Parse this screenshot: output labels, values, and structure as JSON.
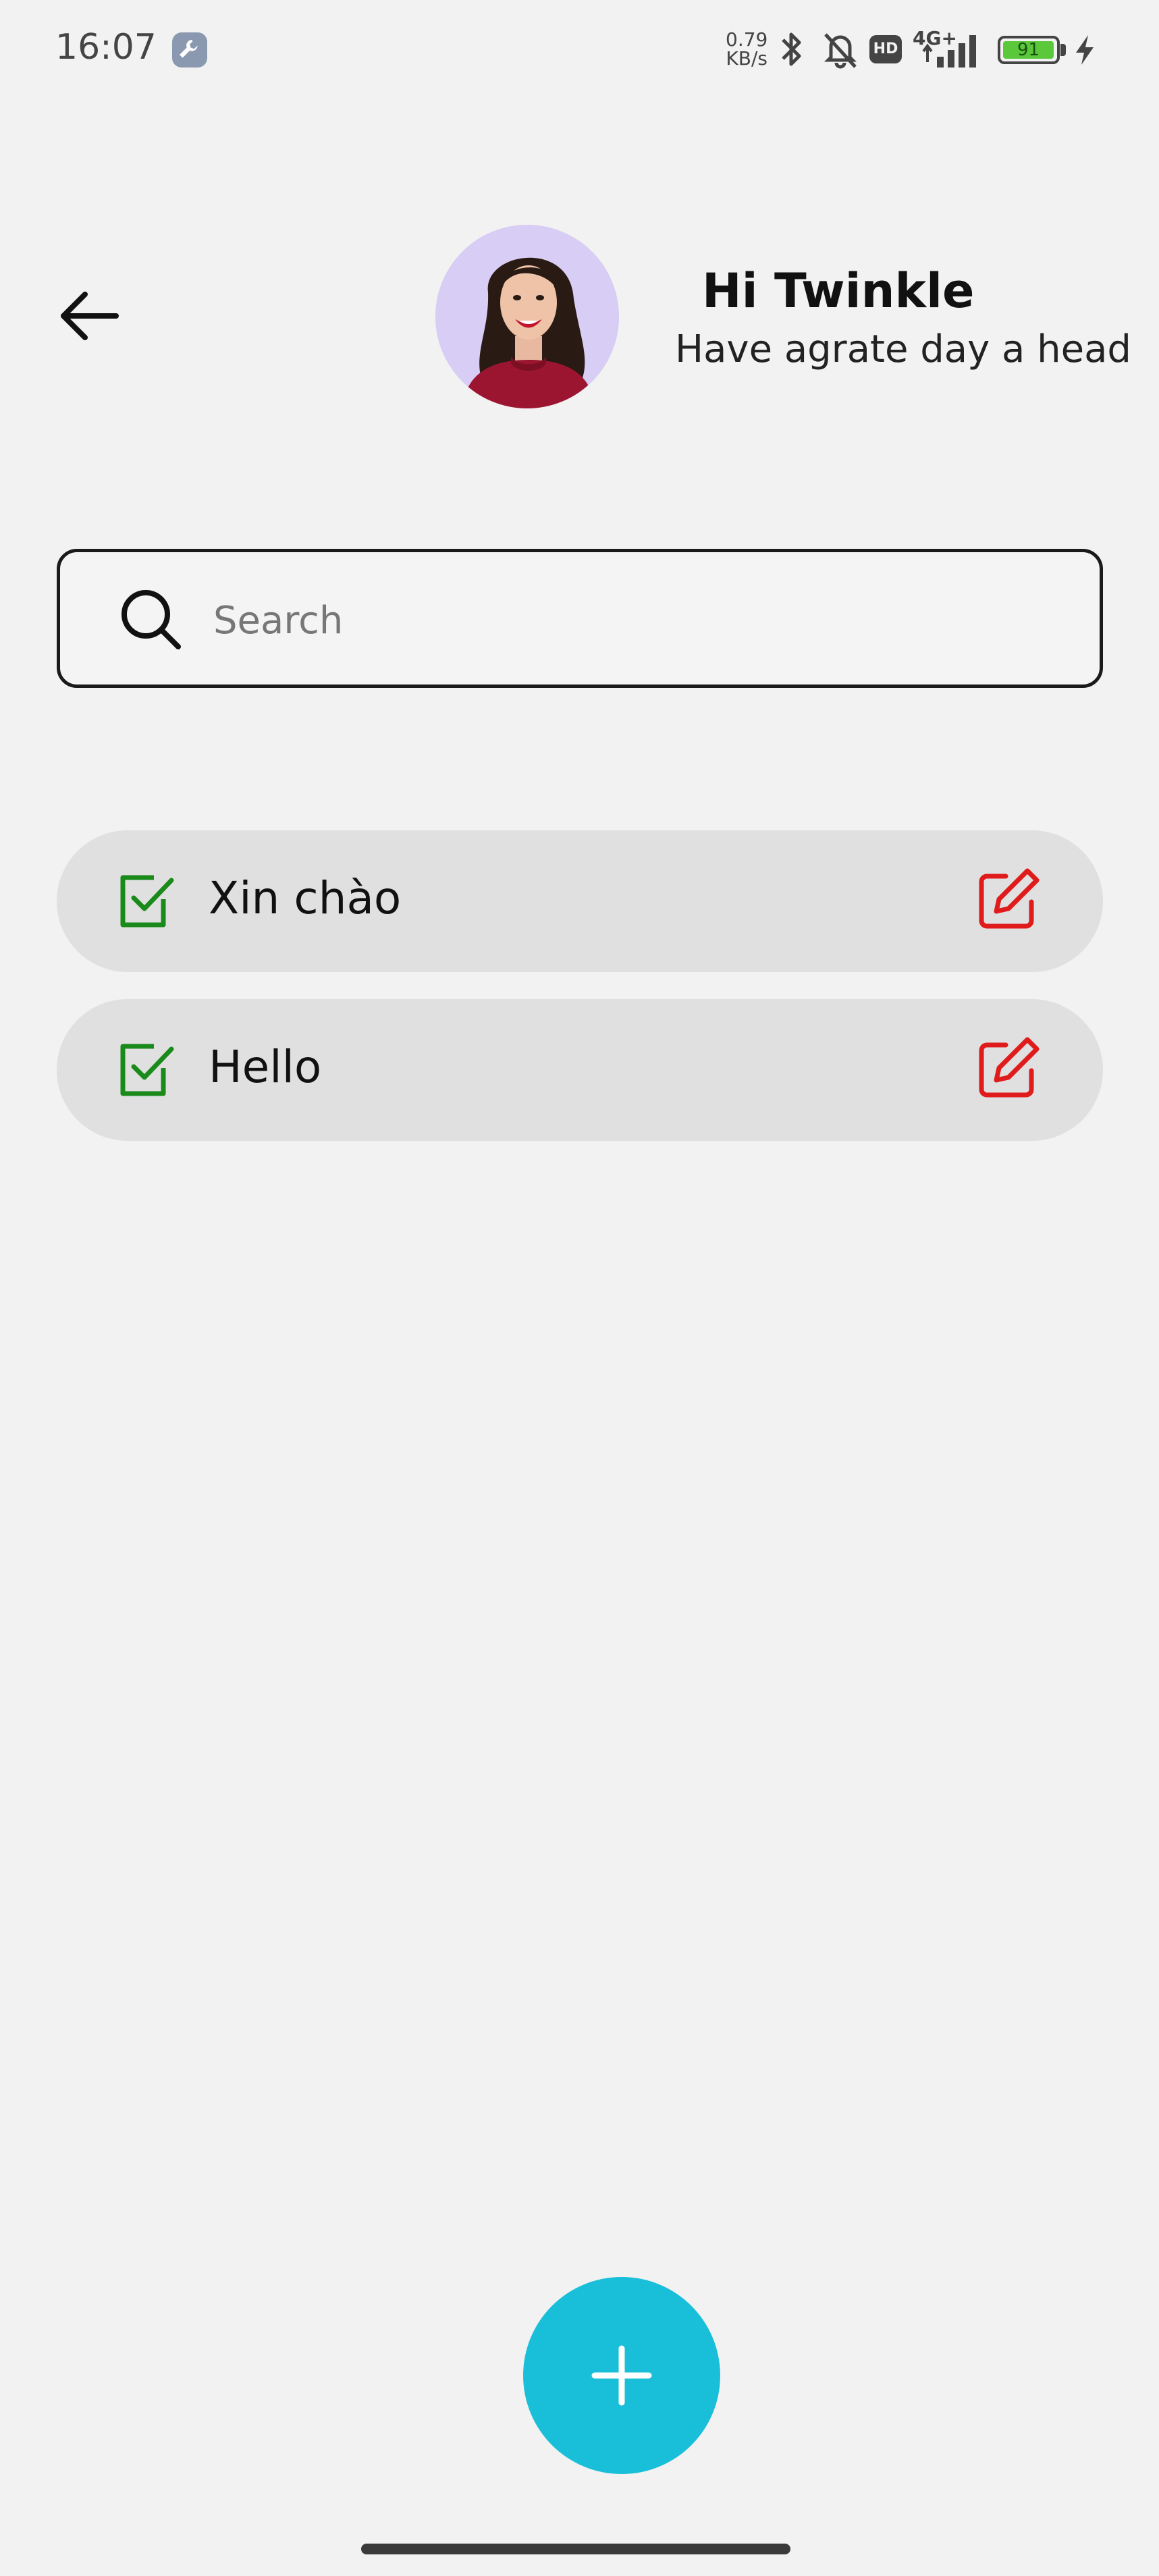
{
  "status_bar": {
    "time": "16:07",
    "net_speed_value": "0.79",
    "net_speed_unit": "KB/s",
    "network": "4G+",
    "hd_badge": "HD",
    "battery": "91",
    "icons": [
      "wrench-icon",
      "bluetooth-icon",
      "bell-off-icon",
      "hd-icon",
      "signal-icon",
      "battery-icon",
      "charging-icon"
    ]
  },
  "header": {
    "title": "Hi Twinkle",
    "subtitle": "Have agrate day a head"
  },
  "search": {
    "placeholder": "Search",
    "value": ""
  },
  "todos": [
    {
      "label": "Xin chào",
      "done": true
    },
    {
      "label": "Hello",
      "done": true
    }
  ],
  "colors": {
    "background": "#f2f2f2",
    "check": "#1a8a1a",
    "edit": "#e01b1b",
    "fab": "#19bfd8",
    "todo_bg": "#e0e0e0"
  }
}
